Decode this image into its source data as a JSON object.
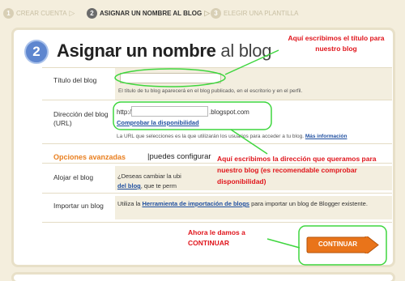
{
  "steps": [
    {
      "num": "1",
      "label": "CREAR CUENTA"
    },
    {
      "num": "2",
      "label": "ASIGNAR UN NOMBRE AL BLOG"
    },
    {
      "num": "3",
      "label": "ELEGIR UNA PLANTILLA"
    }
  ],
  "card": {
    "step_num": "2",
    "title_bold": "Asignar un nombre",
    "title_light": "al blog"
  },
  "form": {
    "title_label": "Título del blog",
    "title_value": "",
    "title_hint": "El título de tu blog aparecerá en el blog publicado, en el escritorio y en el perfil.",
    "address_label": "Dirección del blog (URL)",
    "http_prefix": "http://",
    "url_value": "",
    "domain_suffix": ".blogspot.com",
    "check_link": "Comprobar la disponibilidad",
    "address_hint": "La URL que selecciones es la que utilizarán los usuarios para acceder a tu blog.",
    "more_info": "Más información"
  },
  "advanced": {
    "heading": "Opciones avanzadas",
    "text": "puedes configurar"
  },
  "host": {
    "label": "Alojar el blog",
    "text_a": "¿Deseas cambiar la ubi",
    "link": "del blog",
    "text_b": ", que te perm"
  },
  "import": {
    "label": "Importar un blog",
    "text_a": "Utiliza la",
    "link": "Herramienta de importación de blogs",
    "text_b": "para importar un blog de Blogger existente."
  },
  "continue_button": "CONTINUAR",
  "annotations": {
    "note_title": "Aquí escribimos el título para nuestro blog",
    "note_url": "Aquí escribimos la dirección que queramos para nuestro blog (es recomendable comprobar disponibilidad)",
    "note_continue": "Ahora le damos a CONTINUAR"
  },
  "colors": {
    "accent": "#e97f1f",
    "step_blue": "#5e86cf",
    "annotation_red": "#e0141b",
    "annotation_green": "#3ed63e",
    "link_blue": "#1f4fa0"
  }
}
